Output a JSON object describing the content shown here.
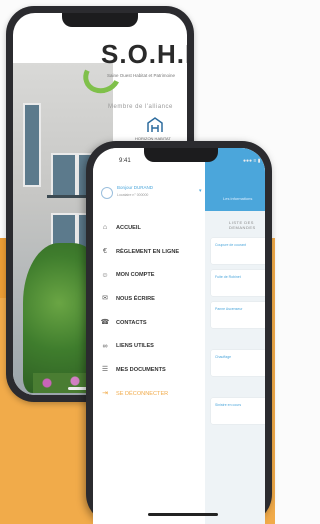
{
  "brand": {
    "logo_text": "S.O.H.P",
    "logo_subtitle": "Saine Ouest Habitat et Patrimoine",
    "member_text": "Membre de l'alliance",
    "partner_label": "HORIZON HABITAT"
  },
  "status": {
    "time": "9:41",
    "right": "●●● ≡ ▮"
  },
  "drawer": {
    "user_name": "Bonjour DURAND",
    "user_id": "Locataire n° 000000",
    "items": [
      {
        "label": "ACCUEIL",
        "icon": "home-icon",
        "glyph": "⌂"
      },
      {
        "label": "RÈGLEMENT EN LIGNE",
        "icon": "euro-icon",
        "glyph": "€"
      },
      {
        "label": "MON COMPTE",
        "icon": "user-icon",
        "glyph": "☺"
      },
      {
        "label": "NOUS ÉCRIRE",
        "icon": "envelope-icon",
        "glyph": "✉"
      },
      {
        "label": "CONTACTS",
        "icon": "phone-icon",
        "glyph": "☎"
      },
      {
        "label": "LIENS UTILES",
        "icon": "link-icon",
        "glyph": "∞"
      },
      {
        "label": "MES DOCUMENTS",
        "icon": "document-icon",
        "glyph": "☰"
      },
      {
        "label": "SE DÉCONNECTER",
        "icon": "logout-icon",
        "glyph": "⇥"
      }
    ]
  },
  "content": {
    "header_title": "Les informations",
    "section_title": "LISTE DES DEMANDES",
    "cards": [
      "Coupure de courant",
      "Fuite de Robinet",
      "Panne Ascenseur",
      "Chauffage",
      "Sinistre en cours"
    ]
  },
  "colors": {
    "accent_blue": "#4ba6db",
    "accent_orange": "#f1ab4a",
    "accent_green": "#7fc04a"
  }
}
